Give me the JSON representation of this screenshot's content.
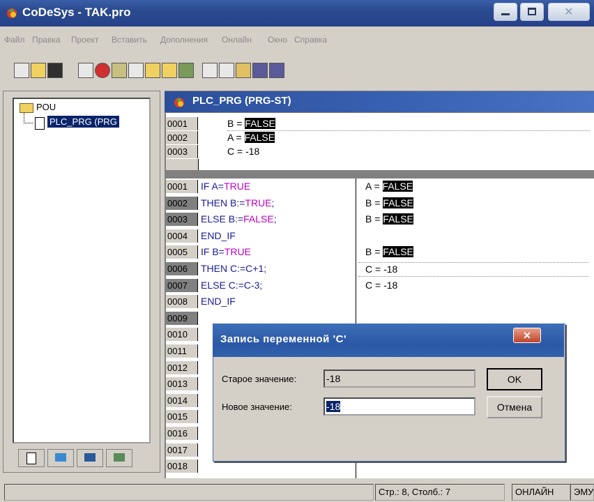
{
  "window": {
    "title": "CoDeSys - TAK.pro"
  },
  "menu": [
    "Файл",
    "Правка",
    "Проект",
    "Вставить",
    "Дополнения",
    "Онлайн",
    "Окно",
    "Справка"
  ],
  "tree": {
    "root": "POU",
    "child": "PLC_PRG (PRG"
  },
  "editor": {
    "title": "PLC_PRG (PRG-ST)",
    "decl_lines": [
      {
        "num": "0001",
        "var": "B = ",
        "val": "FALSE"
      },
      {
        "num": "0002",
        "var": "A = ",
        "val": "FALSE"
      },
      {
        "num": "0003",
        "var": "C = -18",
        "val": ""
      }
    ],
    "code_lines": [
      {
        "num": "0001",
        "a": "IF A=",
        "kw": "TRUE",
        "b": "",
        "mon": "A = ",
        "monv": "FALSE"
      },
      {
        "num": "0002",
        "a": "THEN B:=",
        "kw": "TRUE",
        "b": ";",
        "mon": "B = ",
        "monv": "FALSE"
      },
      {
        "num": "0003",
        "a": "ELSE B:=",
        "kw": "FALSE",
        "b": ";",
        "mon": "B = ",
        "monv": "FALSE"
      },
      {
        "num": "0004",
        "a": "END_IF",
        "kw": "",
        "b": "",
        "mon": "",
        "monv": ""
      },
      {
        "num": "0005",
        "a": "IF B=",
        "kw": "TRUE",
        "b": "",
        "mon": "B = ",
        "monv": "FALSE"
      },
      {
        "num": "0006",
        "a": "THEN C:=C+1;",
        "kw": "",
        "b": "",
        "mon": "C = -18",
        "monv": ""
      },
      {
        "num": "0007",
        "a": "ELSE C:=C-3;",
        "kw": "",
        "b": "",
        "mon": "C = -18",
        "monv": ""
      },
      {
        "num": "0008",
        "a": "END_IF",
        "kw": "",
        "b": "",
        "mon": "",
        "monv": ""
      },
      {
        "num": "0009",
        "a": "",
        "kw": "",
        "b": "",
        "mon": "",
        "monv": ""
      },
      {
        "num": "0010",
        "a": "",
        "kw": "",
        "b": "",
        "mon": "",
        "monv": ""
      },
      {
        "num": "0011",
        "a": "",
        "kw": "",
        "b": "",
        "mon": "",
        "monv": ""
      },
      {
        "num": "0012",
        "a": "",
        "kw": "",
        "b": "",
        "mon": "",
        "monv": ""
      },
      {
        "num": "0013",
        "a": "",
        "kw": "",
        "b": "",
        "mon": "",
        "monv": ""
      },
      {
        "num": "0014",
        "a": "",
        "kw": "",
        "b": "",
        "mon": "",
        "monv": ""
      },
      {
        "num": "0015",
        "a": "",
        "kw": "",
        "b": "",
        "mon": "",
        "monv": ""
      },
      {
        "num": "0016",
        "a": "",
        "kw": "",
        "b": "",
        "mon": "",
        "monv": ""
      },
      {
        "num": "0017",
        "a": "",
        "kw": "",
        "b": "",
        "mon": "",
        "monv": ""
      },
      {
        "num": "0018",
        "a": "",
        "kw": "",
        "b": "",
        "mon": "",
        "monv": ""
      }
    ]
  },
  "dialog": {
    "title": "Запись переменной 'C'",
    "old_label": "Старое значение:",
    "old_value": "-18",
    "new_label": "Новое значение:",
    "new_value": "-18",
    "ok": "OK",
    "cancel": "Отмена"
  },
  "status": {
    "position": "Стр.: 8, Столб.: 7",
    "mode": "ОНЛАЙН",
    "emu": "ЭМУ"
  }
}
